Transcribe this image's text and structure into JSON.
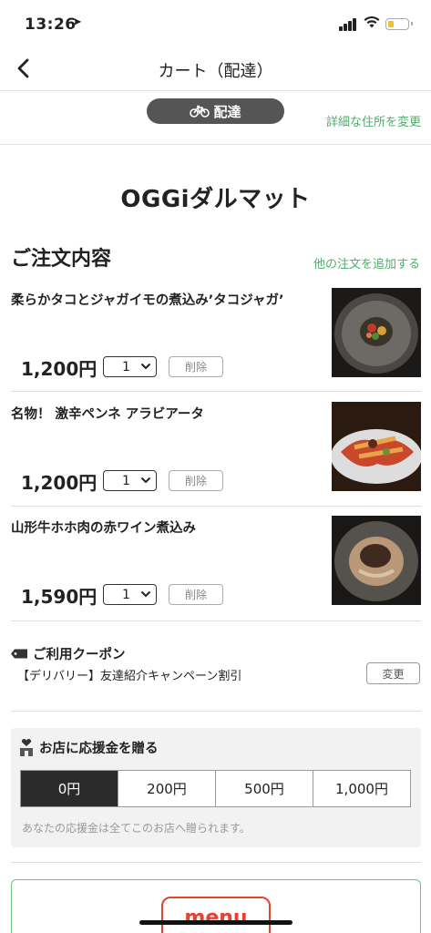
{
  "status": {
    "time": "13:26",
    "location_glyph": "➤"
  },
  "nav": {
    "title": "カート（配達）",
    "back_icon": "chevron-left-icon"
  },
  "mode": {
    "label": "配達",
    "icon": "bicycle-icon",
    "address_link": "詳細な住所を変更"
  },
  "shop": {
    "name": "OGGiダルマット"
  },
  "order": {
    "heading": "ご注文内容",
    "add_other": "他の注文を追加する",
    "items": [
      {
        "name": "柔らかタコとジャガイモの煮込み’タコジャガ’",
        "price": "1,200円",
        "qty": "1",
        "delete": "削除"
      },
      {
        "name": "名物！ 激辛ペンネ アラビアータ",
        "price": "1,200円",
        "qty": "1",
        "delete": "削除"
      },
      {
        "name": "山形牛ホホ肉の赤ワイン煮込み",
        "price": "1,590円",
        "qty": "1",
        "delete": "削除"
      }
    ]
  },
  "coupon": {
    "heading": "ご利用クーポン",
    "text": "【デリバリー】友達紹介キャンペーン割引",
    "change": "変更"
  },
  "support": {
    "heading": "お店に応援金を贈る",
    "amounts": [
      "0円",
      "200円",
      "500円",
      "1,000円"
    ],
    "selected_index": 0,
    "note": "あなたの応援金は全てこのお店へ贈られます。"
  },
  "promo": {
    "logo_text": "menu"
  },
  "colors": {
    "accent_green": "#4cae6a",
    "pill_dark": "#555555",
    "brand_red": "#e5432f"
  }
}
